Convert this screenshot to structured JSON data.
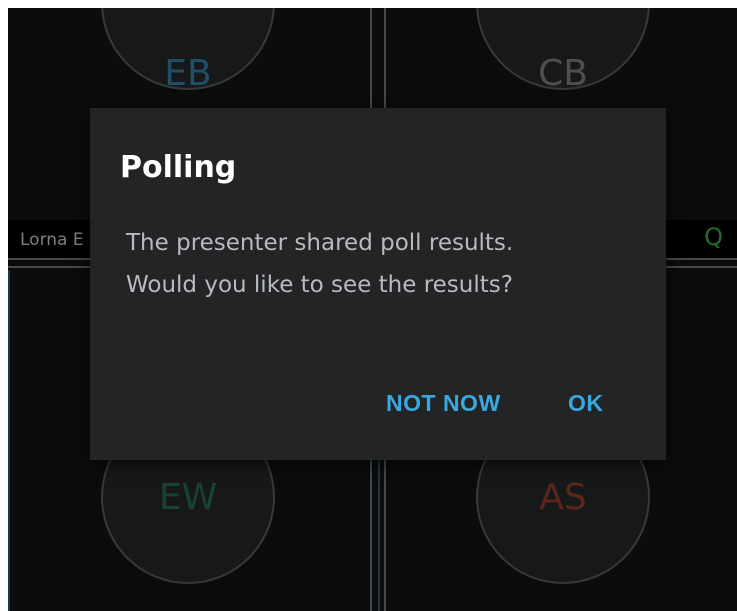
{
  "tiles": {
    "top_left": {
      "initials": "EB",
      "color": "#2a6a8a"
    },
    "top_right": {
      "initials": "CB",
      "color": "#6a6a6a"
    },
    "bottom_left": {
      "initials": "EW",
      "color": "#1f5a47"
    },
    "bottom_right": {
      "initials": "AS",
      "color": "#7a3524"
    }
  },
  "participant_bar": {
    "left_name": "Lorna E",
    "right_indicator": "Q"
  },
  "dialog": {
    "title": "Polling",
    "message_line1": "The presenter shared poll results.",
    "message_line2": "Would you like to see the results?",
    "buttons": {
      "not_now": "NOT NOW",
      "ok": "OK"
    },
    "accent_color": "#3aa8de"
  }
}
